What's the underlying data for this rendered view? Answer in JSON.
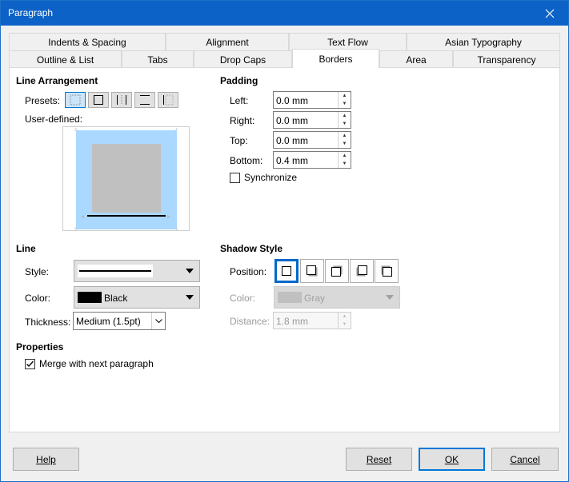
{
  "window": {
    "title": "Paragraph"
  },
  "tabs": {
    "row1": [
      "Indents & Spacing",
      "Alignment",
      "Text Flow",
      "Asian Typography"
    ],
    "row2": [
      "Outline & List",
      "Tabs",
      "Drop Caps",
      "Borders",
      "Area",
      "Transparency"
    ],
    "active": "Borders"
  },
  "line_arrangement": {
    "header": "Line Arrangement",
    "presets_label": "Presets:",
    "user_defined_label": "User-defined:"
  },
  "padding": {
    "header": "Padding",
    "left": {
      "label": "Left:",
      "value": "0.0 mm"
    },
    "right": {
      "label": "Right:",
      "value": "0.0 mm"
    },
    "top": {
      "label": "Top:",
      "value": "0.0 mm"
    },
    "bottom": {
      "label": "Bottom:",
      "value": "0.4 mm"
    },
    "synchronize": {
      "label": "Synchronize",
      "checked": false
    }
  },
  "line": {
    "header": "Line",
    "style_label": "Style:",
    "color_label": "Color:",
    "color_value": "Black",
    "color_swatch": "#000000",
    "thickness_label": "Thickness:",
    "thickness_value": "Medium (1.5pt)"
  },
  "shadow": {
    "header": "Shadow Style",
    "position_label": "Position:",
    "color_label": "Color:",
    "color_value": "Gray",
    "color_swatch": "#c0c0c0",
    "distance_label": "Distance:",
    "distance_value": "1.8 mm"
  },
  "properties": {
    "header": "Properties",
    "merge": {
      "label": "Merge with next paragraph",
      "checked": true
    }
  },
  "buttons": {
    "help": "Help",
    "reset": "Reset",
    "ok": "OK",
    "cancel": "Cancel"
  },
  "colors": {
    "accent": "#0078d7",
    "titlebar": "#0c62c7",
    "preview_bg": "#aad8ff",
    "preview_page": "#c0c0c0"
  }
}
